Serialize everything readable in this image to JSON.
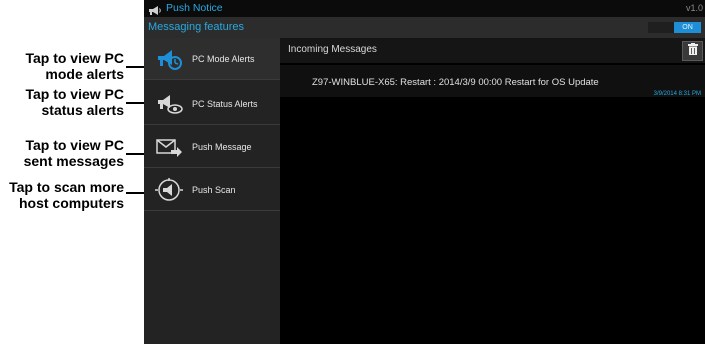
{
  "callouts": {
    "pc_mode": [
      "Tap to view PC",
      "mode alerts"
    ],
    "pc_status": [
      "Tap to view PC",
      "status alerts"
    ],
    "push_message": [
      "Tap to view PC",
      "sent messages"
    ],
    "push_scan": [
      "Tap to scan more",
      "host computers"
    ]
  },
  "app": {
    "title": "Push Notice",
    "version": "v1.0",
    "features_label": "Messaging features",
    "toggle": {
      "off_label": "",
      "on_label": "ON",
      "state": "on"
    }
  },
  "sidebar": {
    "items": [
      {
        "label": "PC Mode Alerts",
        "icon": "pc-mode-alerts-icon",
        "active": true
      },
      {
        "label": "PC Status Alerts",
        "icon": "pc-status-alerts-icon",
        "active": false
      },
      {
        "label": "Push Message",
        "icon": "push-message-icon",
        "active": false
      },
      {
        "label": "Push Scan",
        "icon": "push-scan-icon",
        "active": false
      }
    ]
  },
  "content": {
    "header": "Incoming Messages",
    "messages": [
      {
        "text": "Z97-WINBLUE-X65: Restart : 2014/3/9 00:00 Restart for OS Update",
        "time": "3/9/2014  8:31 PM"
      }
    ]
  },
  "colors": {
    "accent": "#28a9e0",
    "toggle_on": "#1e8fd6",
    "sidebar_bg": "#232323",
    "content_bg": "#000000"
  }
}
